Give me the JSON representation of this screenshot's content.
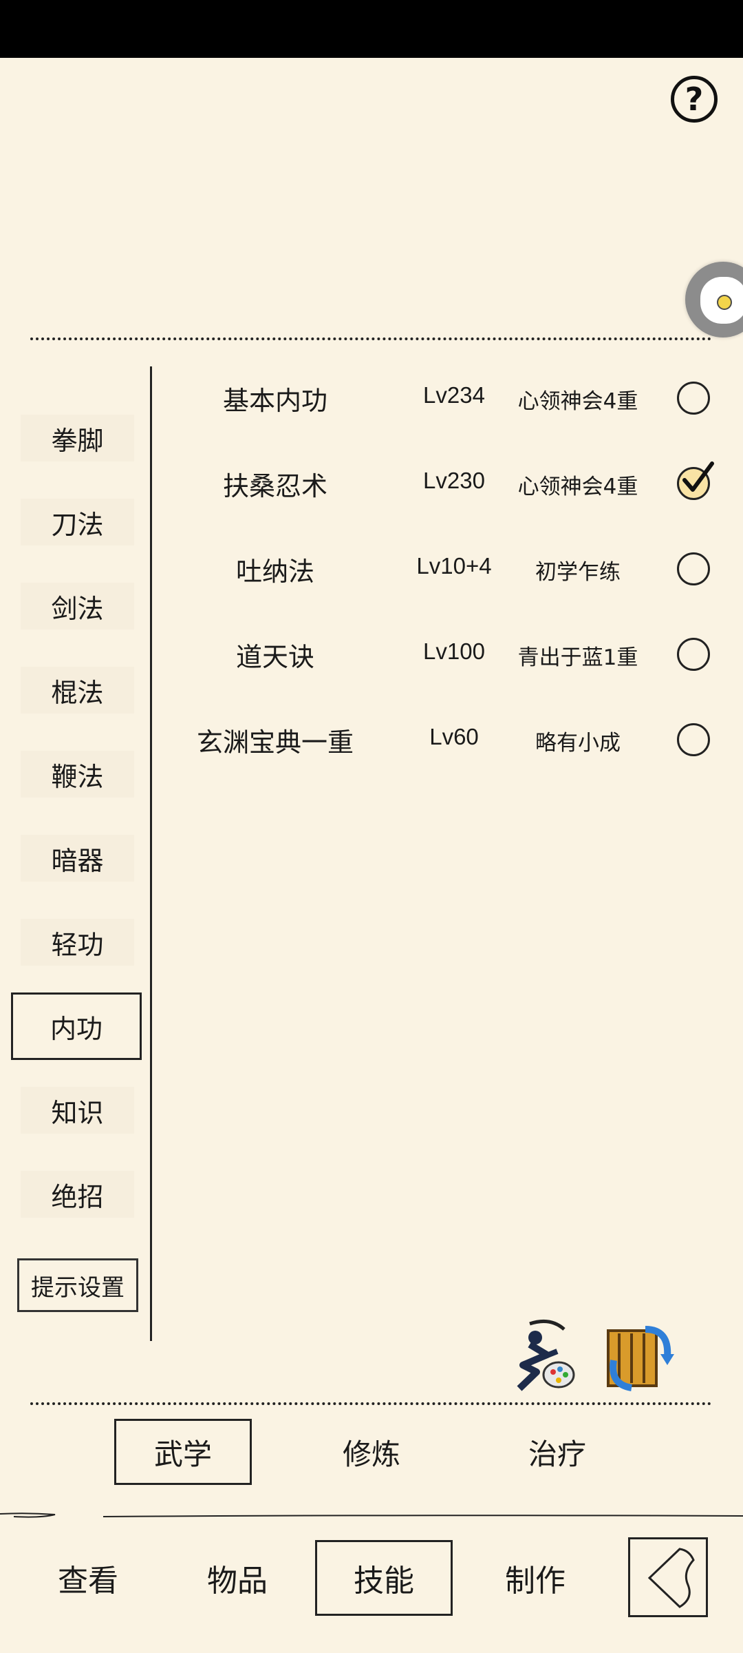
{
  "help": {
    "icon": "question-icon",
    "label": "?"
  },
  "float_button": {
    "icon": "game-assistant-icon"
  },
  "categories": [
    {
      "label": "拳脚"
    },
    {
      "label": "刀法"
    },
    {
      "label": "剑法"
    },
    {
      "label": "棍法"
    },
    {
      "label": "鞭法"
    },
    {
      "label": "暗器"
    },
    {
      "label": "轻功"
    },
    {
      "label": "内功",
      "active": true
    },
    {
      "label": "知识"
    },
    {
      "label": "绝招"
    }
  ],
  "tips_setting": "提示设置",
  "skills": [
    {
      "name": "基本内功",
      "level": "Lv234",
      "stage": "心领神会4重",
      "checked": false
    },
    {
      "name": "扶桑忍术",
      "level": "Lv230",
      "stage": "心领神会4重",
      "checked": true
    },
    {
      "name": "吐纳法",
      "level": "Lv10+4",
      "stage": "初学乍练",
      "checked": false
    },
    {
      "name": "道天诀",
      "level": "Lv100",
      "stage": "青出于蓝1重",
      "checked": false
    },
    {
      "name": "玄渊宝典一重",
      "level": "Lv60",
      "stage": "略有小成",
      "checked": false
    }
  ],
  "action_icons": [
    "martial-figure-palette-icon",
    "scroll-swap-icon"
  ],
  "subtabs": [
    {
      "label": "武学",
      "active": true
    },
    {
      "label": "修炼"
    },
    {
      "label": "治疗"
    }
  ],
  "nav": [
    {
      "label": "查看"
    },
    {
      "label": "物品"
    },
    {
      "label": "技能",
      "active": true
    },
    {
      "label": "制作"
    }
  ],
  "back_icon": "back-arrow-icon"
}
